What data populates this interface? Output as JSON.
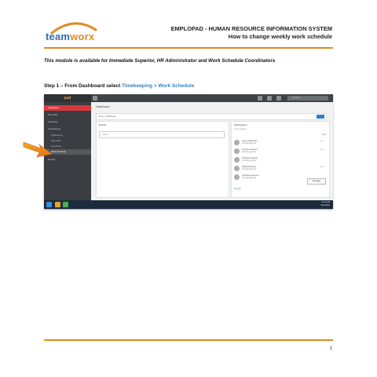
{
  "header": {
    "logo_part1": "team",
    "logo_part2": "worx",
    "title": "EMPLOPAD - HUMAN RESOURCE INFORMATION SYSTEM",
    "subtitle": "How to change weekly work schedule"
  },
  "module_note": "This module is available for Immediate Superior, HR Administrator and Work Schedule Coordinators",
  "step": {
    "prefix": "Step 1 – From Dashboard select",
    "link": "Timekeeping > Work Schedule"
  },
  "screenshot": {
    "brand": "pad",
    "user_label": "••••• •••••",
    "sidebar_items": [
      {
        "label": "Dashboard",
        "style": "active"
      },
      {
        "label": "My Profile",
        "style": "normal"
      },
      {
        "label": "Employee",
        "style": "normal"
      },
      {
        "label": "Timekeeping",
        "style": "normal"
      },
      {
        "label": "Applications",
        "style": "sub"
      },
      {
        "label": "Approvals",
        "style": "sub"
      },
      {
        "label": "Timesheet",
        "style": "sub"
      },
      {
        "label": "Work Schedule",
        "style": "sel"
      },
      {
        "label": "Payroll",
        "style": "normal"
      }
    ],
    "page_heading": "Dashboard",
    "crumb": "Home > Dashboard",
    "left_panel_title": "Events",
    "search_placeholder": "Search...",
    "right_panel_title": "Notifications",
    "right_panel_sub": "Latest updates",
    "right_link": "View",
    "entries": [
      {
        "name": "Leave Application",
        "detail": "Pending approval",
        "tag": "new"
      },
      {
        "name": "Overtime Request",
        "detail": "Pending approval",
        "tag": "new"
      },
      {
        "name": "Schedule Change",
        "detail": "Pending approval",
        "tag": ""
      },
      {
        "name": "Official Business",
        "detail": "Pending approval",
        "tag": "new"
      },
      {
        "name": "Undertime Request",
        "detail": "Pending approval",
        "tag": ""
      }
    ],
    "message_button": "Message",
    "view_all": "View All",
    "clock_time": "10:24 AM",
    "clock_date": "8/12/2016"
  },
  "footer": {
    "page_number": "1"
  },
  "colors": {
    "accent_orange": "#e08a1e",
    "link_blue": "#3a7fc4",
    "sidebar_active": "#d9393b"
  }
}
